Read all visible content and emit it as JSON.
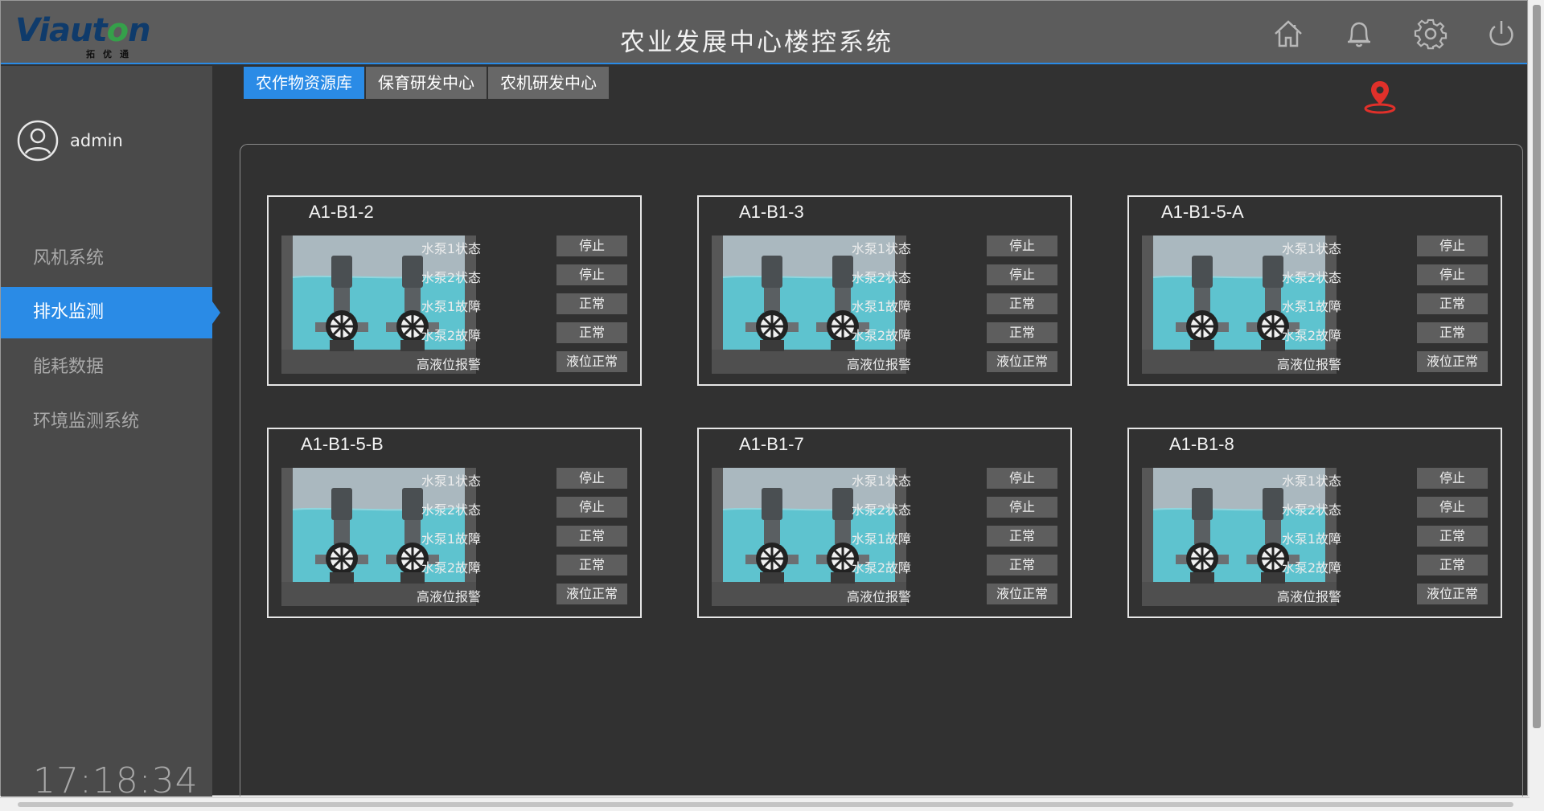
{
  "header": {
    "logo_text_left": "V",
    "logo_text_mid": "iaut",
    "logo_text_o": "o",
    "logo_text_right": "n",
    "logo_sub": "拓优通",
    "title": "农业发展中心楼控系统",
    "icons": [
      "home-icon",
      "bell-icon",
      "gear-icon",
      "power-icon"
    ]
  },
  "sidebar": {
    "user": "admin",
    "items": [
      {
        "label": "风机系统",
        "active": false
      },
      {
        "label": "排水监测",
        "active": true
      },
      {
        "label": "能耗数据",
        "active": false
      },
      {
        "label": "环境监测系统",
        "active": false
      }
    ],
    "clock": "17:18:34"
  },
  "tabs": [
    {
      "label": "农作物资源库",
      "active": true
    },
    {
      "label": "保育研发中心",
      "active": false
    },
    {
      "label": "农机研发中心",
      "active": false
    }
  ],
  "cards": [
    {
      "title": "A1-B1-2",
      "rows": [
        {
          "label": "水泵1状态",
          "value": "停止"
        },
        {
          "label": "水泵2状态",
          "value": "停止"
        },
        {
          "label": "水泵1故障",
          "value": "正常"
        },
        {
          "label": "水泵2故障",
          "value": "正常"
        },
        {
          "label": "高液位报警",
          "value": "液位正常"
        }
      ]
    },
    {
      "title": "A1-B1-3",
      "rows": [
        {
          "label": "水泵1状态",
          "value": "停止"
        },
        {
          "label": "水泵2状态",
          "value": "停止"
        },
        {
          "label": "水泵1故障",
          "value": "正常"
        },
        {
          "label": "水泵2故障",
          "value": "正常"
        },
        {
          "label": "高液位报警",
          "value": "液位正常"
        }
      ]
    },
    {
      "title": "A1-B1-5-A",
      "rows": [
        {
          "label": "水泵1状态",
          "value": "停止"
        },
        {
          "label": "水泵2状态",
          "value": "停止"
        },
        {
          "label": "水泵1故障",
          "value": "正常"
        },
        {
          "label": "水泵2故障",
          "value": "正常"
        },
        {
          "label": "高液位报警",
          "value": "液位正常"
        }
      ]
    },
    {
      "title": "A1-B1-5-B",
      "rows": [
        {
          "label": "水泵1状态",
          "value": "停止"
        },
        {
          "label": "水泵2状态",
          "value": "停止"
        },
        {
          "label": "水泵1故障",
          "value": "正常"
        },
        {
          "label": "水泵2故障",
          "value": "正常"
        },
        {
          "label": "高液位报警",
          "value": "液位正常"
        }
      ]
    },
    {
      "title": "A1-B1-7",
      "rows": [
        {
          "label": "水泵1状态",
          "value": "停止"
        },
        {
          "label": "水泵2状态",
          "value": "停止"
        },
        {
          "label": "水泵1故障",
          "value": "正常"
        },
        {
          "label": "水泵2故障",
          "value": "正常"
        },
        {
          "label": "高液位报警",
          "value": "液位正常"
        }
      ]
    },
    {
      "title": "A1-B1-8",
      "rows": [
        {
          "label": "水泵1状态",
          "value": "停止"
        },
        {
          "label": "水泵2状态",
          "value": "停止"
        },
        {
          "label": "水泵1故障",
          "value": "正常"
        },
        {
          "label": "水泵2故障",
          "value": "正常"
        },
        {
          "label": "高液位报警",
          "value": "液位正常"
        }
      ]
    }
  ],
  "colors": {
    "accent": "#2a8be6",
    "header_bg": "#5c5c5c",
    "sidebar_bg": "#4a4a4a",
    "content_bg": "#313131",
    "value_bg": "#5e5e5e",
    "water": "#5ec3cf",
    "pin": "#e0302a"
  }
}
